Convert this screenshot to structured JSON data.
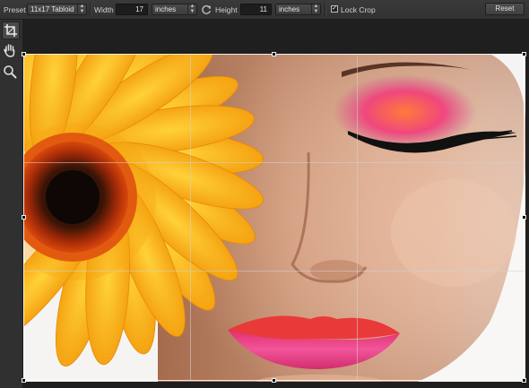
{
  "toolbar": {
    "preset_label": "Preset",
    "preset_value": "11x17 Tabloid",
    "width_label": "Width",
    "width_value": "17",
    "width_unit": "inches",
    "height_label": "Height",
    "height_value": "11",
    "height_unit": "inches",
    "lock_crop_label": "Lock Crop",
    "lock_crop_checked": true,
    "reset_label": "Reset"
  },
  "tools": [
    {
      "name": "crop-tool",
      "icon": "crop-icon",
      "active": true
    },
    {
      "name": "hand-tool",
      "icon": "hand-icon",
      "active": false
    },
    {
      "name": "zoom-tool",
      "icon": "magnifier-icon",
      "active": false
    }
  ],
  "image": {
    "subject": "woman-with-orange-gerbera-flower"
  }
}
